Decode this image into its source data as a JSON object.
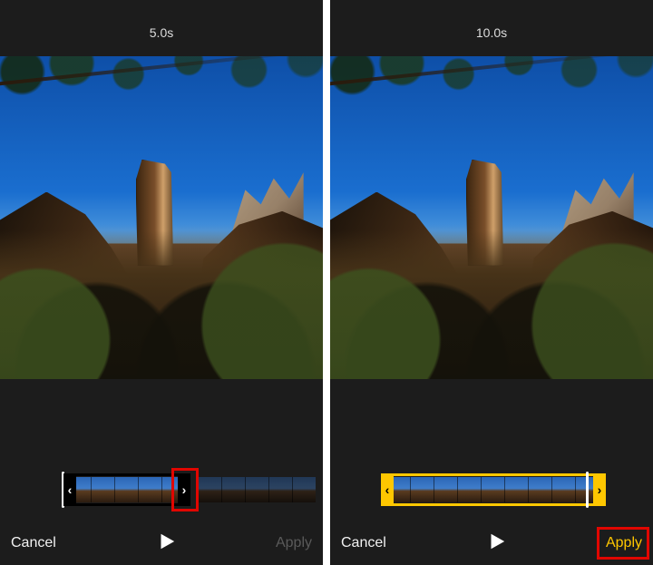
{
  "left": {
    "duration": "5.0s",
    "cancel_label": "Cancel",
    "apply_label": "Apply",
    "apply_enabled": false,
    "selection_color": "#000000",
    "thumb_total": 10,
    "selected_start": 0,
    "selected_end": 5
  },
  "right": {
    "duration": "10.0s",
    "cancel_label": "Cancel",
    "apply_label": "Apply",
    "apply_enabled": true,
    "selection_color": "#ffc700",
    "thumb_total": 9,
    "selected_start": 0,
    "selected_end": 9
  },
  "icons": {
    "play": "play-icon",
    "handle_left": "‹",
    "handle_right": "›"
  }
}
